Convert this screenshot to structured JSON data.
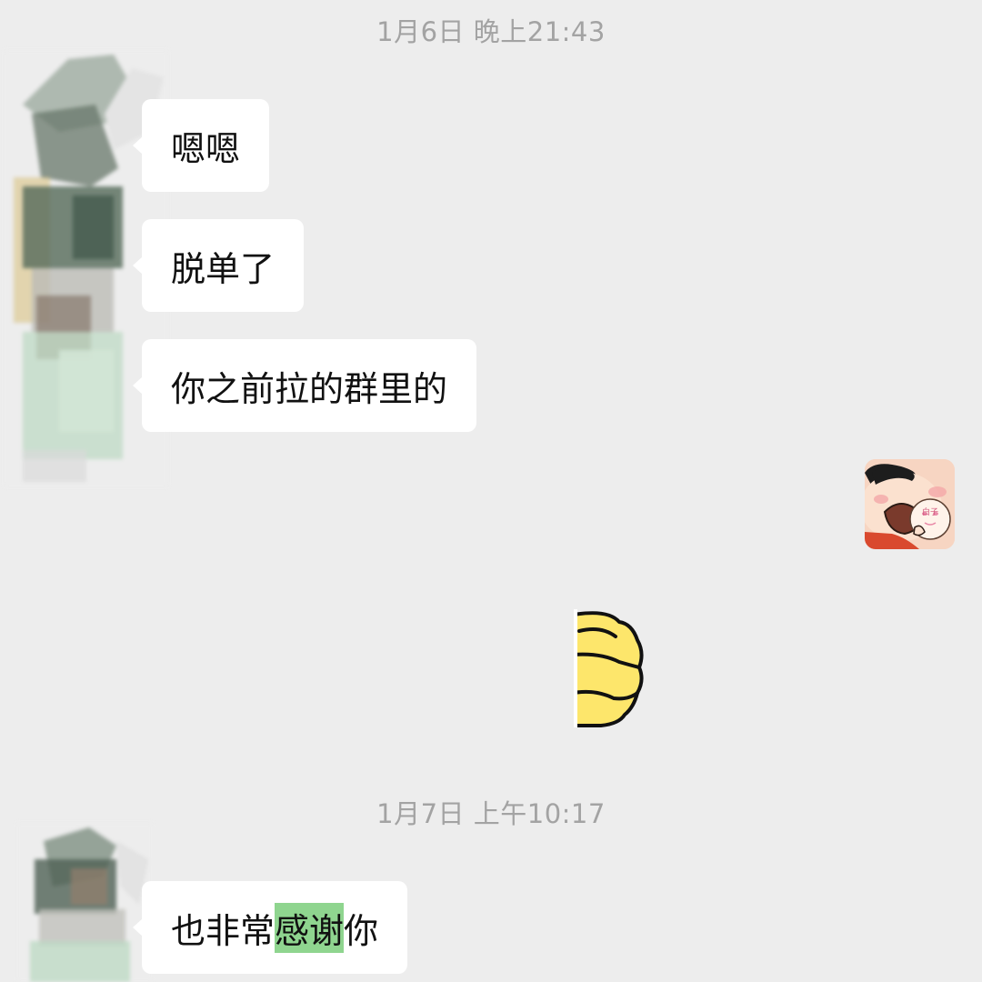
{
  "chat": {
    "timestamp_1": "1月6日 晚上21:43",
    "timestamp_2": "1月7日 上午10:17",
    "messages_day1": [
      {
        "sender": "contact",
        "text": "嗯嗯"
      },
      {
        "sender": "contact",
        "text": "脱单了"
      },
      {
        "sender": "contact",
        "text": "你之前拉的群里的"
      }
    ],
    "stickers": [
      {
        "sender": "self",
        "icon": "cartoon-boy-hugging-baby-sticker",
        "text": "白子"
      },
      {
        "sender": "self",
        "icon": "yellow-thumb-sticker"
      }
    ],
    "message_day2": {
      "sender": "contact",
      "before": "也非常",
      "highlight": "感谢",
      "after": "你"
    }
  },
  "colors": {
    "background": "#ededed",
    "bubble": "#ffffff",
    "timestamp": "#a3a3a3",
    "highlight": "#8fd58f",
    "sticker_yellow": "#fde66b"
  }
}
